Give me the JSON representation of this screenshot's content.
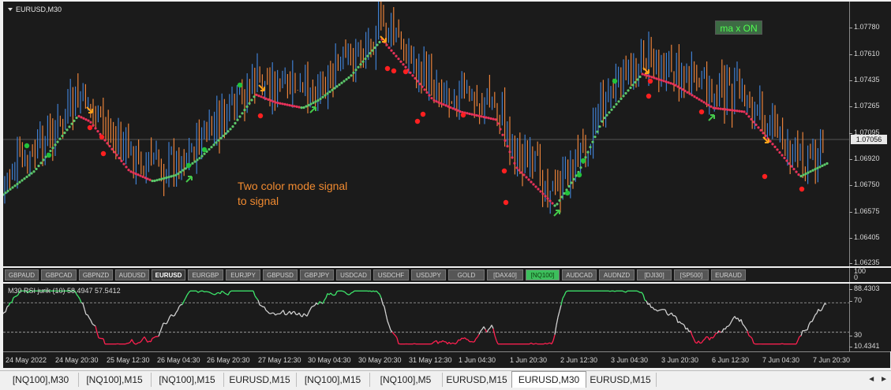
{
  "chart": {
    "symbol": "EURUSD,M30",
    "current_price": "1.07056",
    "price_ticks": [
      "1.07780",
      "1.07610",
      "1.07435",
      "1.07265",
      "1.07095",
      "1.06920",
      "1.06750",
      "1.06575",
      "1.06405",
      "1.06235"
    ],
    "ma_button": "ma x ON",
    "annotation_line1": "Two color mode signal",
    "annotation_line2": "to signal",
    "colors": {
      "bull": "#3f7fd0",
      "bear": "#e8813a",
      "ma_up": "#5cc86a",
      "ma_down": "#e8325a",
      "dot_up": "#22c33a",
      "dot_down": "#ff2020",
      "arrow_up": "#44c84a",
      "arrow_down": "#ffa21a"
    }
  },
  "symbols": [
    "GBPAUD",
    "GBPCAD",
    "GBPNZD",
    "AUDUSD",
    "EURUSD",
    "EURGBP",
    "EURJPY",
    "GBPUSD",
    "GBPJPY",
    "USDCAD",
    "USDCHF",
    "USDJPY",
    "GOLD",
    "[DAX40]",
    "[NQ100]",
    "AUDCAD",
    "AUDNZD",
    "[DJI30]",
    "[SP500]",
    "EURAUD"
  ],
  "active_symbol": "EURUSD",
  "highlight_symbol": "[NQ100]",
  "sep_axis": {
    "top": "100",
    "bottom": "0"
  },
  "indicator": {
    "title": "M30  RSI jurik (10) 58.4947 57.5412",
    "ticks": [
      "88.4303",
      "70",
      "30",
      "10.4341"
    ],
    "levels": {
      "upper": 70,
      "lower": 30
    },
    "colors": {
      "line": "#d0d0d0",
      "overbought": "#3ee86c",
      "oversold": "#ff2050"
    }
  },
  "time_labels": [
    "24 May 2022",
    "24 May 20:30",
    "25 May 12:30",
    "26 May 04:30",
    "26 May 20:30",
    "27 May 12:30",
    "30 May 04:30",
    "30 May 20:30",
    "31 May 12:30",
    "1 Jun 04:30",
    "1 Jun 20:30",
    "2 Jun 12:30",
    "3 Jun 04:30",
    "3 Jun 20:30",
    "6 Jun 12:30",
    "7 Jun 04:30",
    "7 Jun 20:30"
  ],
  "tabs": [
    "[NQ100],M30",
    "[NQ100],M15",
    "[NQ100],M15",
    "EURUSD,M15",
    "[NQ100],M15",
    "[NQ100],M5",
    "EURUSD,M15",
    "EURUSD,M30",
    "EURUSD,M15"
  ],
  "active_tab": "EURUSD,M30",
  "tab_scroll": {
    "left": "◄",
    "right": "►"
  }
}
